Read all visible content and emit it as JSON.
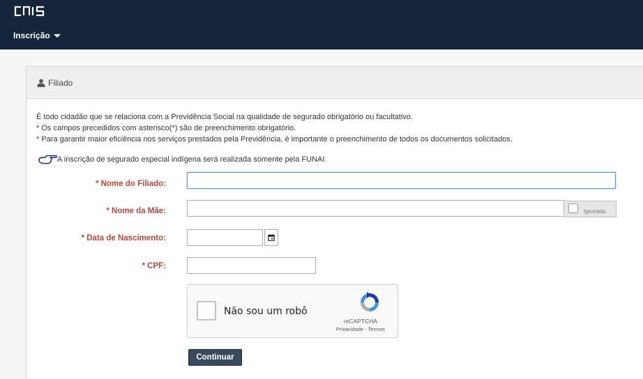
{
  "header": {
    "logo_text": "CNIS",
    "menu_label": "Inscrição"
  },
  "panel": {
    "title": "Filiado",
    "info_lines": [
      "É todo cidadão que se relaciona com a Previdência Social na qualidade de segurado obrigatório ou facultativo.",
      "* Os campos precedidos com asterisco(*) são de preenchimento obrigatório.",
      "* Para garantir maior eficiência nos serviços prestados pela Previdência, é importante o preenchimento de todos os documentos solicitados."
    ],
    "notice": "A inscrição de segurado especial indígena será realizada somente pela FUNAI."
  },
  "form": {
    "nome_filiado_label": "* Nome do Filiado:",
    "nome_filiado_value": "",
    "nome_mae_label": "* Nome da Mãe:",
    "nome_mae_value": "",
    "ignorado_label": "Ignorado",
    "data_nascimento_label": "* Data de Nascimento:",
    "data_nascimento_value": "",
    "cpf_label": "* CPF:",
    "cpf_value": ""
  },
  "captcha": {
    "text": "Não sou um robô",
    "brand": "reCAPTCHA",
    "links": "Privacidade - Termos"
  },
  "actions": {
    "continuar_label": "Continuar"
  },
  "colors": {
    "header_bg": "#15253c",
    "label_red": "#b8483a",
    "button_bg": "#3a4a5e",
    "focus_blue": "#5b8fd6"
  }
}
